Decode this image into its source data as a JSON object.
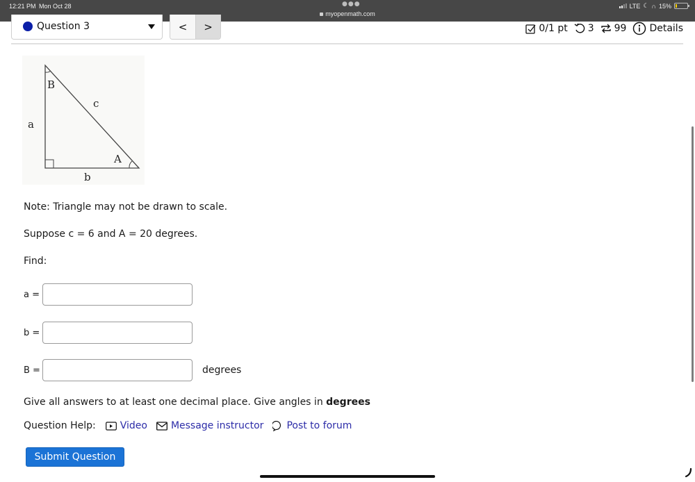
{
  "status_bar": {
    "time": "12:21 PM",
    "date": "Mon Oct 28",
    "url": "myopenmath.com",
    "network": "LTE",
    "battery": "15%",
    "battery_level": 0.15,
    "icons": [
      "signal-icon",
      "moon-icon",
      "headphones-icon",
      "battery-icon"
    ]
  },
  "header": {
    "question_select": {
      "selected": "Question 3",
      "status_color": "#0b1fa8"
    },
    "nav": {
      "prev_label": "<",
      "next_label": ">"
    },
    "score": {
      "points": "0/1 pt",
      "retries": "3",
      "attempts": "99",
      "details_label": "Details"
    }
  },
  "figure": {
    "labels": {
      "vertex_B": "B",
      "vertex_A": "A",
      "side_a": "a",
      "side_b": "b",
      "side_c": "c"
    }
  },
  "question": {
    "note": "Note: Triangle may not be drawn to scale.",
    "given": "Suppose c = 6 and A = 20 degrees.",
    "find": "Find:",
    "answers": [
      {
        "label": "a =",
        "value": "",
        "unit": ""
      },
      {
        "label": "b =",
        "value": "",
        "unit": ""
      },
      {
        "label": "B =",
        "value": "",
        "unit": "degrees"
      }
    ],
    "instructions_prefix": "Give all answers to at least one decimal place. Give angles in ",
    "instructions_bold": "degrees"
  },
  "help": {
    "label": "Question Help:",
    "links": [
      {
        "label": "Video",
        "icon": "video-icon"
      },
      {
        "label": "Message instructor",
        "icon": "mail-icon"
      },
      {
        "label": "Post to forum",
        "icon": "forum-icon"
      }
    ]
  },
  "submit_label": "Submit Question",
  "colors": {
    "accent": "#1b73d6",
    "link": "#2c2ca8",
    "status_bar": "#474747"
  }
}
